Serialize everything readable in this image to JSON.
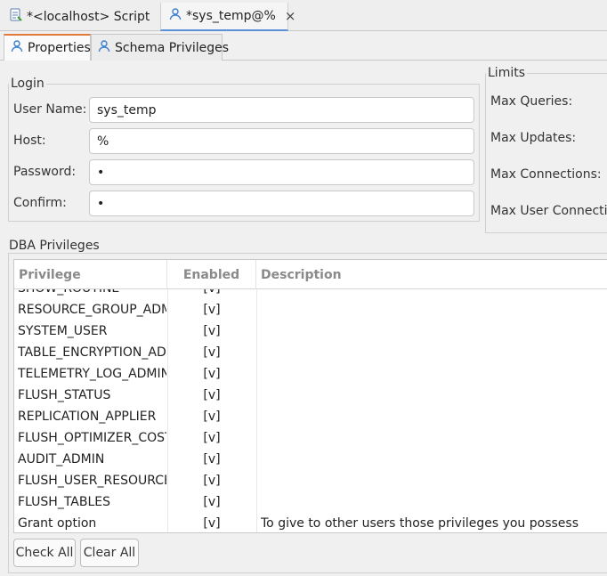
{
  "editor_tabs": [
    {
      "label": "*<localhost> Script",
      "icon": "script-icon"
    },
    {
      "label": "*sys_temp@%",
      "icon": "user-icon",
      "close": "×"
    }
  ],
  "sub_tabs": [
    {
      "label": "Properties",
      "icon": "user-icon"
    },
    {
      "label": "Schema Privileges",
      "icon": "user-icon"
    }
  ],
  "login": {
    "legend": "Login",
    "user_name": {
      "label": "User Name:",
      "value": "sys_temp"
    },
    "host": {
      "label": "Host:",
      "value": "%"
    },
    "password": {
      "label": "Password:",
      "value": "•"
    },
    "confirm": {
      "label": "Confirm:",
      "value": "•"
    }
  },
  "limits": {
    "legend": "Limits",
    "max_queries": "Max Queries:",
    "max_updates": "Max Updates:",
    "max_connections": "Max Connections:",
    "max_user_connections": "Max User Connectio"
  },
  "dba": {
    "legend": "DBA Privileges",
    "columns": [
      "Privilege",
      "Enabled",
      "Description"
    ],
    "rows": [
      {
        "privilege": "SHOW_ROUTINE",
        "enabled": "[v]",
        "description": ""
      },
      {
        "privilege": "RESOURCE_GROUP_ADMIN",
        "enabled": "[v]",
        "description": ""
      },
      {
        "privilege": "SYSTEM_USER",
        "enabled": "[v]",
        "description": ""
      },
      {
        "privilege": "TABLE_ENCRYPTION_ADMIN",
        "enabled": "[v]",
        "description": ""
      },
      {
        "privilege": "TELEMETRY_LOG_ADMIN",
        "enabled": "[v]",
        "description": ""
      },
      {
        "privilege": "FLUSH_STATUS",
        "enabled": "[v]",
        "description": ""
      },
      {
        "privilege": "REPLICATION_APPLIER",
        "enabled": "[v]",
        "description": ""
      },
      {
        "privilege": "FLUSH_OPTIMIZER_COSTS",
        "enabled": "[v]",
        "description": ""
      },
      {
        "privilege": "AUDIT_ADMIN",
        "enabled": "[v]",
        "description": ""
      },
      {
        "privilege": "FLUSH_USER_RESOURCES",
        "enabled": "[v]",
        "description": ""
      },
      {
        "privilege": "FLUSH_TABLES",
        "enabled": "[v]",
        "description": ""
      },
      {
        "privilege": "Grant option",
        "enabled": "[v]",
        "description": "To give to other users those privileges you possess"
      }
    ],
    "check_all": "Check All",
    "clear_all": "Clear All"
  },
  "colors": {
    "active_tab_underline": "#5b8fd6",
    "active_subtab_top": "#e07b39"
  }
}
